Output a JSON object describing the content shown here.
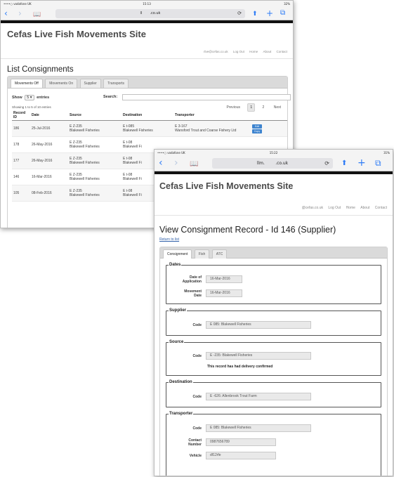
{
  "phone1": {
    "status": {
      "carrier": "••••○ vodafone UK",
      "time": "15:13",
      "battery": "32%"
    },
    "safari": {
      "nav_back": "‹",
      "nav_forward": "›",
      "bookmarks": "📖",
      "url_prefix": "ll",
      "url_suffix": ".co.uk",
      "reload": "⟳",
      "share": "⬆",
      "new_tab": "+",
      "tabs": "⧉"
    },
    "site_title": "Cefas Live Fish Movements Site",
    "top_links": {
      "email": "rlve@cefas.co.uk",
      "logout": "Log Out",
      "home": "Home",
      "about": "About",
      "contact": "Contact"
    },
    "heading": "List Consignments",
    "tabs": [
      "Movements Off",
      "Movements On",
      "Supplier",
      "Transports"
    ],
    "show_label": "Show",
    "show_value": "5",
    "entries_label": "entries",
    "search_label": "Search:",
    "info_text": "Showing 1 to 5 of 10 entries",
    "pager": {
      "previous": "Previous",
      "page1": "1",
      "page2": "2",
      "next": "Next"
    },
    "columns": [
      "Record ID",
      "Date",
      "Source",
      "Destination",
      "Transporter",
      ""
    ],
    "rows": [
      {
        "id": "186",
        "date": "25-Jul-2016",
        "src_code": "E    Z-235",
        "src_name": "Blakewell Fisheries",
        "dst_code": "E    t-085",
        "dst_name": "Blakewell Fisheries",
        "trans_code": "E    3-167",
        "trans_name": "Wansford Trout and Coarse Fishery Ltd",
        "btn1": "Edit",
        "btn2": "Copy"
      },
      {
        "id": "178",
        "date": "26-May-2016",
        "src_code": "E    Z-235",
        "src_name": "Blakewell Fisheries",
        "dst_code": "E    t-08",
        "dst_name": "Blakewell Fi",
        "trans_code": "",
        "trans_name": "",
        "btn1": "",
        "btn2": ""
      },
      {
        "id": "177",
        "date": "26-May-2016",
        "src_code": "E    Z-235",
        "src_name": "Blakewell Fisheries",
        "dst_code": "E    t-08",
        "dst_name": "Blakewell Fi",
        "trans_code": "",
        "trans_name": "",
        "btn1": "",
        "btn2": ""
      },
      {
        "id": "146",
        "date": "16-Mar-2016",
        "src_code": "E    Z-235",
        "src_name": "Blakewell Fisheries",
        "dst_code": "E    t-08",
        "dst_name": "Blakewell Fi",
        "trans_code": "",
        "trans_name": "",
        "btn1": "",
        "btn2": ""
      },
      {
        "id": "105",
        "date": "08-Feb-2016",
        "src_code": "E    Z-235",
        "src_name": "Blakewell Fisheries",
        "dst_code": "E    t-08",
        "dst_name": "Blakewell Fi",
        "trans_code": "",
        "trans_name": "",
        "btn1": "",
        "btn2": ""
      }
    ]
  },
  "phone2": {
    "status": {
      "carrier": "••••○ vodafone UK",
      "time": "15:22",
      "battery": "31%"
    },
    "safari": {
      "nav_back": "‹",
      "nav_forward": "›",
      "bookmarks": "📖",
      "url_prefix": "llm.",
      "url_suffix": ".co.uk",
      "reload": "⟳",
      "share": "⬆",
      "new_tab": "+",
      "tabs": "⧉"
    },
    "site_title": "Cefas Live Fish Movements Site",
    "top_links": {
      "email": "@cefas.co.uk",
      "logout": "Log Out",
      "home": "Home",
      "about": "About",
      "contact": "Contact"
    },
    "heading": "View Consignment Record - Id 146 (Supplier)",
    "return_link": "Return to list",
    "tabs": [
      "Consignment",
      "Fish",
      "ATC"
    ],
    "dates": {
      "legend": "Dates",
      "app_label_1": "Date of",
      "app_label_2": "Application",
      "app_value": "16-Mar-2016",
      "move_label_1": "Movement",
      "move_label_2": "Date",
      "move_value": "16-Mar-2016"
    },
    "supplier": {
      "legend": "Supplier",
      "code_label": "Code",
      "code_value": "E        085:  Blakewell Fisheries"
    },
    "source": {
      "legend": "Source",
      "code_label": "Code",
      "code_value": "E          -235:  Blakewell Fisheries",
      "note": "This record has had delivery confirmed"
    },
    "destination": {
      "legend": "Destination",
      "code_label": "Code",
      "code_value": "E          -626:  Allenbrook Trout Farm"
    },
    "transporter": {
      "legend": "Transporter",
      "code_label": "Code",
      "code_value": "E        085:  Blakewell Fisheries",
      "contact_label_1": "Contact",
      "contact_label_2": "Number",
      "contact_value": "0987656789",
      "vehicle_label": "Vehicle",
      "vehicle_value": "df12rfe"
    }
  }
}
